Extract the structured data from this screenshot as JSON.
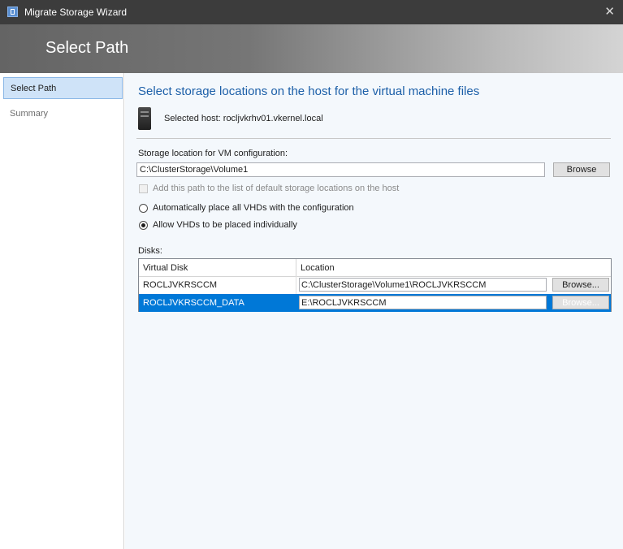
{
  "window": {
    "title": "Migrate Storage Wizard",
    "close_glyph": "✕"
  },
  "header": {
    "title": "Select Path"
  },
  "sidebar": {
    "items": [
      {
        "label": "Select Path",
        "active": true
      },
      {
        "label": "Summary",
        "active": false
      }
    ]
  },
  "main": {
    "heading": "Select storage locations on the host for the virtual machine files",
    "host_label": "Selected host:",
    "host_name": "rocljvkrhv01.vkernel.local",
    "storage_label": "Storage location for VM configuration:",
    "storage_value": "C:\\ClusterStorage\\Volume1",
    "browse_label": "Browse",
    "add_path_label": "Add this path to the list of default storage locations on the host",
    "add_path_checked": false,
    "radio_auto_label": "Automatically place all VHDs with the configuration",
    "radio_individual_label": "Allow VHDs to be placed individually",
    "selected_radio": "individual",
    "disks_label": "Disks:",
    "disks": {
      "columns": [
        "Virtual Disk",
        "Location"
      ],
      "rows": [
        {
          "name": "ROCLJVKRSCCM",
          "location": "C:\\ClusterStorage\\Volume1\\ROCLJVKRSCCM",
          "button": "Browse...",
          "selected": false
        },
        {
          "name": "ROCLJVKRSCCM_DATA",
          "location": "E:\\ROCLJVKRSCCM",
          "button": "Browse...",
          "selected": true
        }
      ]
    }
  },
  "colors": {
    "accent": "#1c5fa8",
    "selection": "#0078d7",
    "titlebar": "#3c3c3c"
  },
  "icons": [
    "app-icon",
    "close-icon",
    "server-icon"
  ]
}
